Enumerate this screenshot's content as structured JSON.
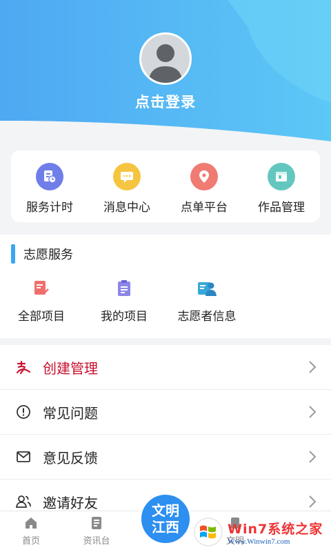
{
  "header": {
    "login_text": "点击登录",
    "avatar_icon": "user-avatar-icon"
  },
  "quick_actions": [
    {
      "label": "服务计时",
      "icon": "timer-document-icon",
      "color": "#6f7ee8"
    },
    {
      "label": "消息中心",
      "icon": "message-icon",
      "color": "#f5c542"
    },
    {
      "label": "点单平台",
      "icon": "location-pin-icon",
      "color": "#f07b73"
    },
    {
      "label": "作品管理",
      "icon": "works-box-icon",
      "color": "#63c7c0"
    }
  ],
  "volunteer": {
    "title": "志愿服务",
    "items": [
      {
        "label": "全部项目",
        "icon": "all-projects-icon"
      },
      {
        "label": "我的项目",
        "icon": "my-projects-icon"
      },
      {
        "label": "志愿者信息",
        "icon": "volunteer-info-icon"
      }
    ]
  },
  "menu": [
    {
      "label": "创建管理",
      "icon": "create-manage-icon"
    },
    {
      "label": "常见问题",
      "icon": "faq-icon"
    },
    {
      "label": "意见反馈",
      "icon": "feedback-mail-icon"
    },
    {
      "label": "邀请好友",
      "icon": "invite-friends-icon"
    }
  ],
  "tabbar": {
    "home": "首页",
    "news": "资讯台",
    "wenming": "文明",
    "center_logo_top": "文明",
    "center_logo_bottom": "江西"
  },
  "watermark": {
    "big": "Win7系统之家",
    "small": "Www.Winwin7.com"
  }
}
